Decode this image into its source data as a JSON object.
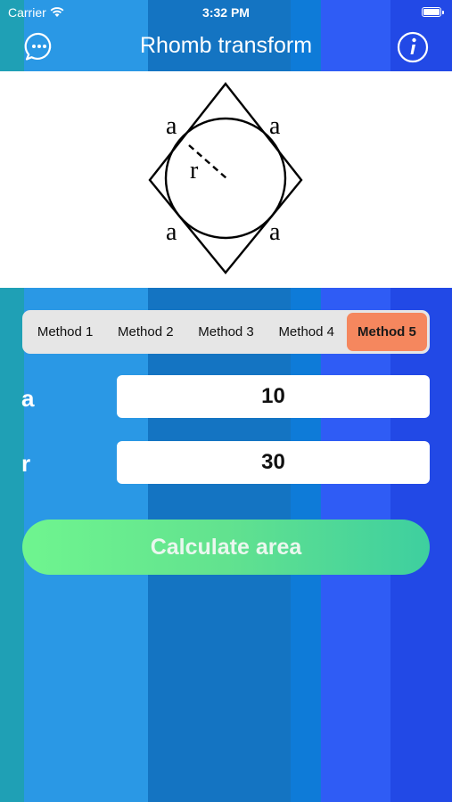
{
  "status_bar": {
    "carrier": "Carrier",
    "time": "3:32 PM"
  },
  "nav": {
    "title": "Rhomb transform",
    "chat_icon": "chat-bubble-icon",
    "info_icon": "info-icon"
  },
  "figure": {
    "side_label": "a",
    "radius_label": "r"
  },
  "methods": {
    "options": [
      "Method 1",
      "Method 2",
      "Method 3",
      "Method 4",
      "Method 5"
    ],
    "selected": "Method 5",
    "selected_color": "#f5875e"
  },
  "inputs": {
    "a": {
      "label": "a",
      "value": "10"
    },
    "r": {
      "label": "r",
      "value": "30"
    }
  },
  "calculate_button": {
    "label": "Calculate area"
  },
  "colors": {
    "bands": [
      "#1fa0b5",
      "#2a98e5",
      "#1474c2",
      "#0e7bd8",
      "#1d7ef3",
      "#2f5cf5",
      "#2249e6"
    ]
  }
}
